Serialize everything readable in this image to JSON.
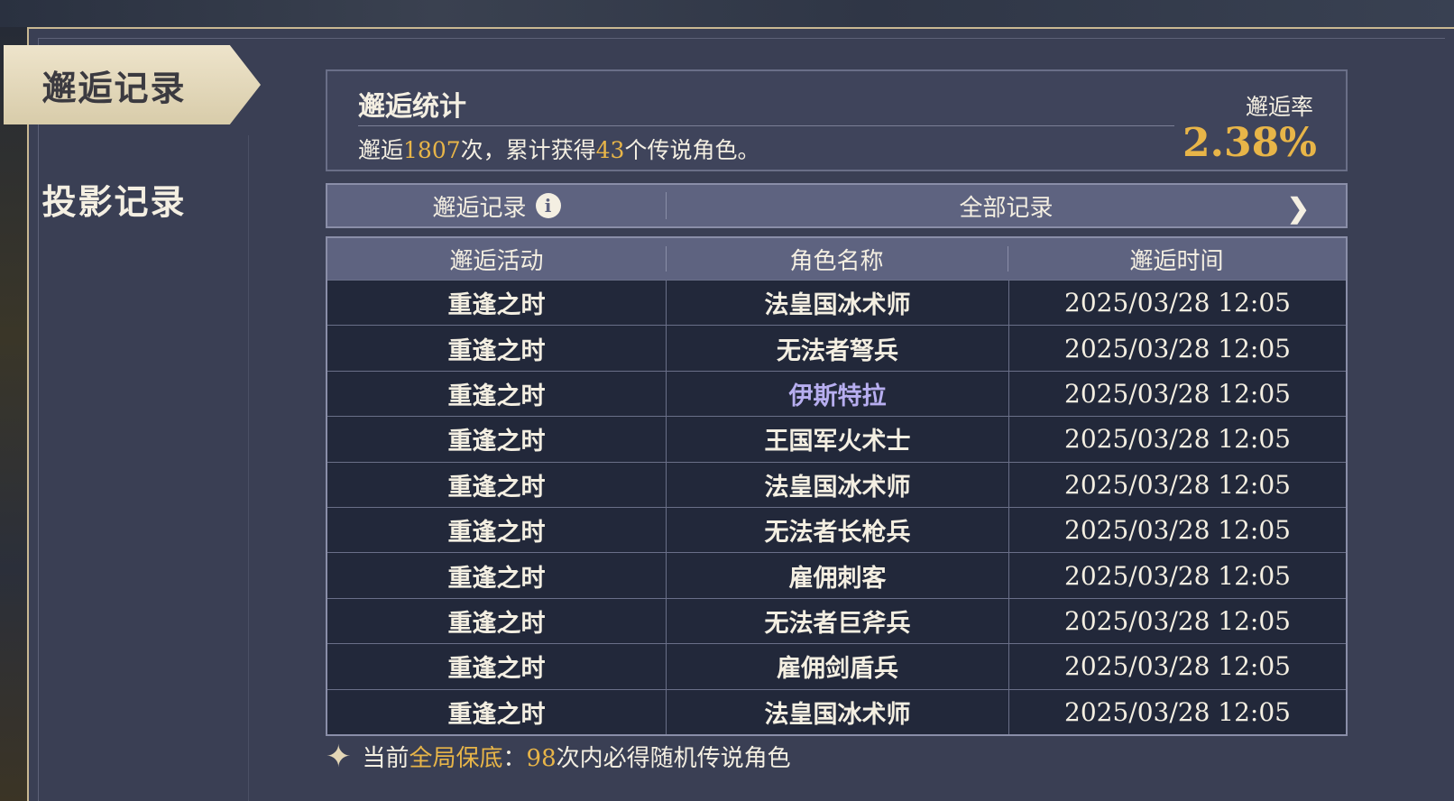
{
  "sidebar": {
    "tabs": [
      {
        "label": "邂逅记录",
        "active": true
      },
      {
        "label": "投影记录",
        "active": false
      }
    ]
  },
  "stats": {
    "title": "邂逅统计",
    "desc_prefix": "邂逅",
    "total_count": "1807",
    "desc_mid": "次，累计获得",
    "legend_count": "43",
    "desc_suffix": "个传说角色。",
    "rate_label": "邂逅率",
    "rate_value": "2.38%"
  },
  "record_bar": {
    "left_label": "邂逅记录",
    "info_icon": "info-icon",
    "filter_label": "全部记录",
    "chevron_icon": "chevron-right-icon"
  },
  "table": {
    "headers": [
      "邂逅活动",
      "角色名称",
      "邂逅时间"
    ],
    "rows": [
      {
        "activity": "重逢之时",
        "name": "法皇国冰术师",
        "time": "2025/03/28 12:05",
        "rarity": "normal"
      },
      {
        "activity": "重逢之时",
        "name": "无法者弩兵",
        "time": "2025/03/28 12:05",
        "rarity": "normal"
      },
      {
        "activity": "重逢之时",
        "name": "伊斯特拉",
        "time": "2025/03/28 12:05",
        "rarity": "rare"
      },
      {
        "activity": "重逢之时",
        "name": "王国军火术士",
        "time": "2025/03/28 12:05",
        "rarity": "normal"
      },
      {
        "activity": "重逢之时",
        "name": "法皇国冰术师",
        "time": "2025/03/28 12:05",
        "rarity": "normal"
      },
      {
        "activity": "重逢之时",
        "name": "无法者长枪兵",
        "time": "2025/03/28 12:05",
        "rarity": "normal"
      },
      {
        "activity": "重逢之时",
        "name": "雇佣刺客",
        "time": "2025/03/28 12:05",
        "rarity": "normal"
      },
      {
        "activity": "重逢之时",
        "name": "无法者巨斧兵",
        "time": "2025/03/28 12:05",
        "rarity": "normal"
      },
      {
        "activity": "重逢之时",
        "name": "雇佣剑盾兵",
        "time": "2025/03/28 12:05",
        "rarity": "normal"
      },
      {
        "activity": "重逢之时",
        "name": "法皇国冰术师",
        "time": "2025/03/28 12:05",
        "rarity": "normal"
      }
    ]
  },
  "footer": {
    "prefix": "当前",
    "highlight": "全局保底",
    "colon": "：",
    "count": "98",
    "suffix": "次内必得随机传说角色"
  },
  "colors": {
    "accent": "#e8b548",
    "rare_name": "#b7aef0",
    "panel": "#3a3f54"
  }
}
